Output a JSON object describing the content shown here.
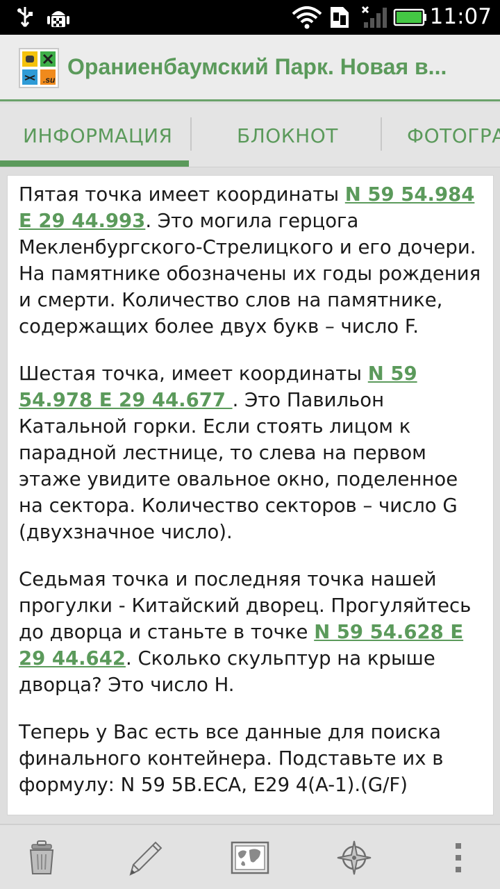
{
  "status_bar": {
    "time": "11:07",
    "icons": [
      "usb-icon",
      "android-debug-icon",
      "wifi-icon",
      "sim-icon",
      "signal-icon",
      "battery-icon"
    ]
  },
  "app_bar": {
    "title": "Ораниенбаумский Парк. Новая в...",
    "logo": "geocaching-su-logo"
  },
  "tabs": [
    {
      "label": "ИНФОРМАЦИЯ",
      "selected": true
    },
    {
      "label": "БЛОКНОТ",
      "selected": false
    },
    {
      "label": "ФОТОГРА",
      "selected": false
    }
  ],
  "content": {
    "p1": {
      "before": "Пятая точка имеет координаты ",
      "coord": "N 59 54.984 E 29 44.993",
      "after": ". Это могила герцога Мекленбургского-Стрелицкого и его дочери. На памятнике обозначены их годы рождения и смерти. Количество слов на памятнике, содержащих более двух букв – число F."
    },
    "p2": {
      "before": "Шестая точка, имеет координаты ",
      "coord": "N 59 54.978 E 29 44.677 ",
      "after": ". Это Павильон Катальной горки. Если стоять лицом к парадной лестнице, то слева на первом этаже увидите овальное окно, поделенное на сектора. Количество секторов – число G (двухзначное число)."
    },
    "p3": {
      "before": "Седьмая точка и последняя точка нашей прогулки - Китайский дворец. Прогуляйтесь до дворца и станьте в точке ",
      "coord": "N 59 54.628 E 29 44.642",
      "after": ". Сколько скульптур на крыше дворца? Это число H."
    },
    "p4": {
      "text": "Теперь у Вас есть все данные для поиска финального контейнера. Подставьте их в формулу: N 59 5B.ECA, E29 4(A-1).(G/F)"
    }
  },
  "colors": {
    "accent": "#5b9a5b",
    "status_bar": "#000000",
    "action_bar": "#ececec",
    "tabs_bg": "#e4e4e4"
  },
  "bottom_bar": {
    "buttons": [
      "trash-icon",
      "pencil-icon",
      "map-icon",
      "compass-icon",
      "overflow-menu-icon"
    ]
  }
}
